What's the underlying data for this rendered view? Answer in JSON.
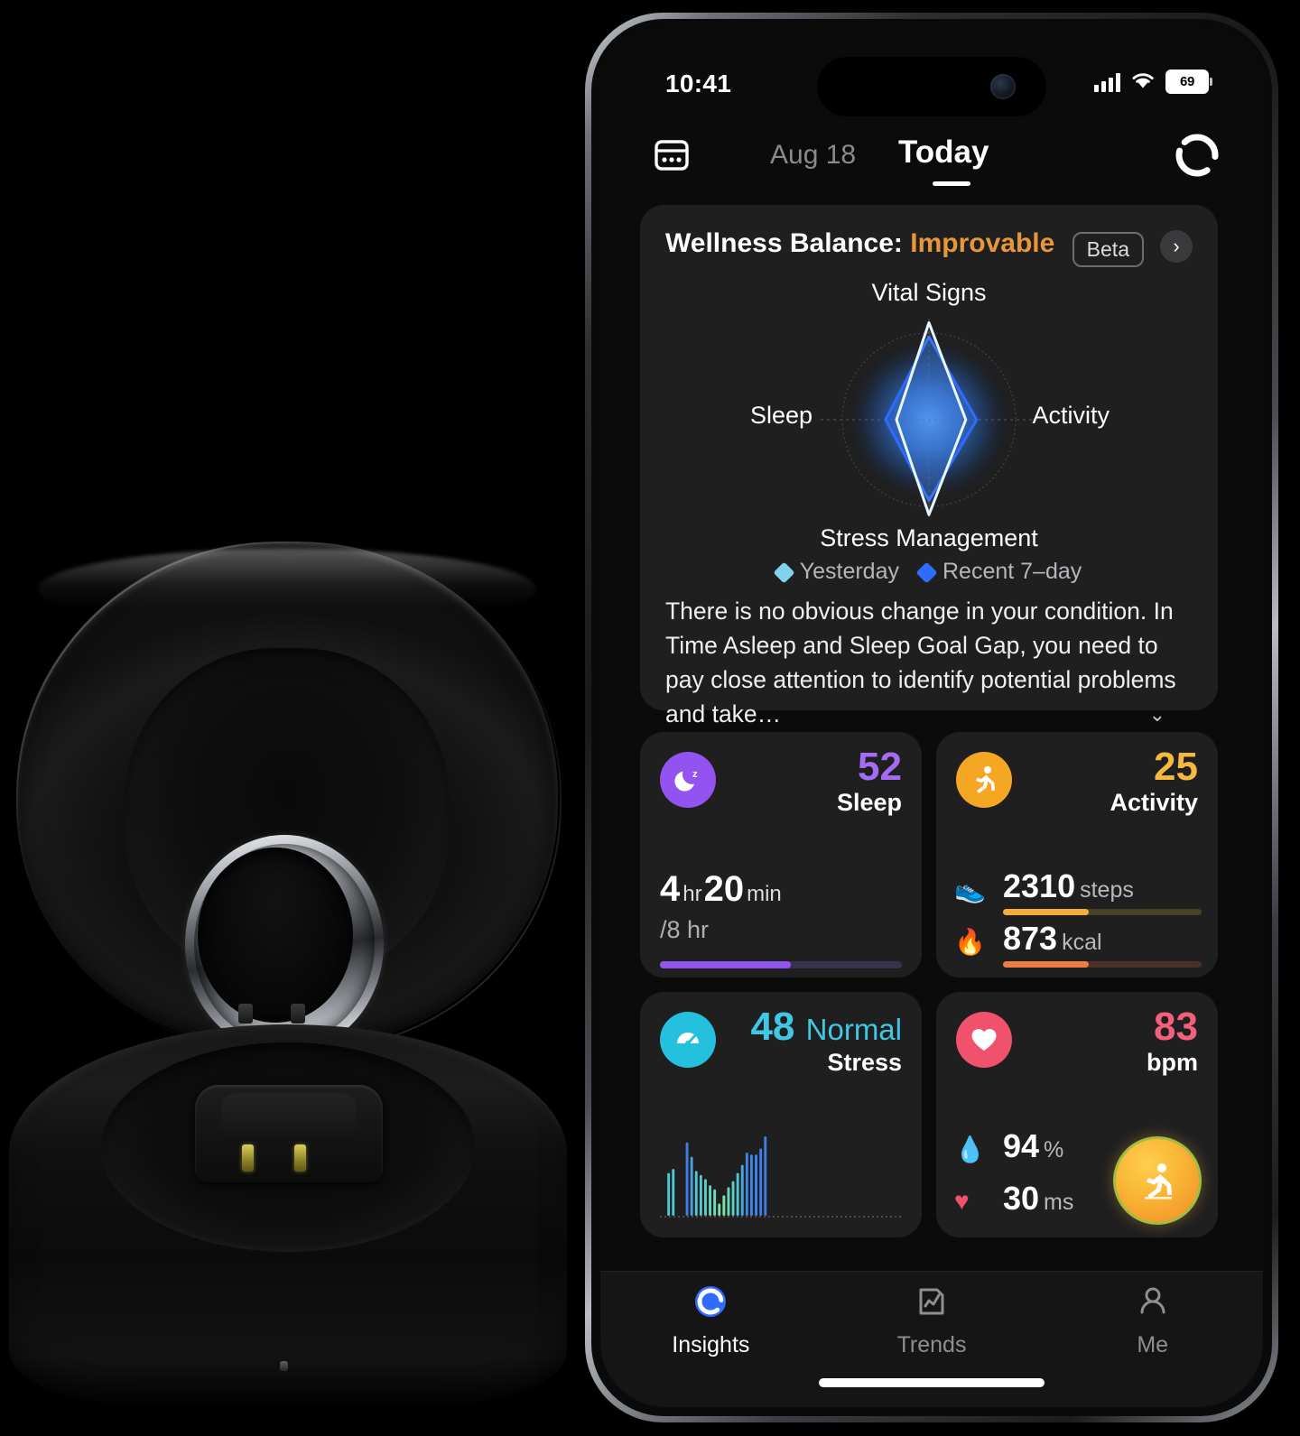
{
  "statusbar": {
    "time": "10:41",
    "battery": "69",
    "icons": [
      "cellular-signal-icon",
      "wifi-icon",
      "battery-icon"
    ]
  },
  "navbar": {
    "calendar_icon": "calendar-card-icon",
    "date": "Aug 18",
    "today": "Today",
    "logo_icon": "ring-logo-icon"
  },
  "wellness": {
    "title_prefix": "Wellness Balance:",
    "status": "Improvable",
    "status_color": "#e8963a",
    "beta_label": "Beta",
    "chevron": "›",
    "description": "There is no obvious change in your condition. In Time Asleep and Sleep Goal Gap, you need to pay close attention to identify potential problems and take…",
    "expand_caret": "⌄",
    "legend": [
      {
        "label": "Yesterday",
        "color": "#7fd3ec"
      },
      {
        "label": "Recent 7–day",
        "color": "#2f6bff"
      }
    ]
  },
  "chart_data": {
    "type": "radar",
    "title": "Wellness Balance",
    "axes": [
      "Vital Signs",
      "Activity",
      "Stress Management",
      "Sleep"
    ],
    "axis_labels": {
      "top": "Vital Signs",
      "right": "Activity",
      "bottom": "Stress Management",
      "left": "Sleep"
    },
    "range": [
      0,
      100
    ],
    "grid": true,
    "legend_position": "bottom",
    "series": [
      {
        "name": "Yesterday",
        "color": "#7fd3ec",
        "values": [
          96,
          34,
          94,
          30
        ]
      },
      {
        "name": "Recent 7–day",
        "color": "#2f6bff",
        "values": [
          82,
          44,
          80,
          40
        ]
      }
    ]
  },
  "metrics": {
    "sleep": {
      "icon": "moon-zzz-icon",
      "icon_color": "#9353f0",
      "score": "52",
      "score_color": "#a46cf5",
      "label": "Sleep",
      "hours": "4",
      "hours_unit": "hr",
      "minutes": "20",
      "minutes_unit": "min",
      "goal": "/8 hr",
      "progress_pct": 54,
      "bar_color": "#9353f0",
      "track_color": "#3a3050"
    },
    "activity": {
      "icon": "running-person-icon",
      "icon_color": "#f5a623",
      "score": "25",
      "score_color": "#f5b940",
      "label": "Activity",
      "rows": [
        {
          "icon": "shoe-icon",
          "glyph": "👟",
          "value": "2310",
          "unit": "steps",
          "progress_pct": 43,
          "color": "#f2ad3b",
          "track": "#4a4226"
        },
        {
          "icon": "flame-icon",
          "glyph": "🔥",
          "value": "873",
          "unit": "kcal",
          "progress_pct": 43,
          "color": "#ef7b47",
          "track": "#4a3026"
        }
      ]
    },
    "stress": {
      "icon": "stress-gauge-icon",
      "icon_color": "#25c0de",
      "score": "48",
      "score_color": "#3fc8e4",
      "status": "Normal",
      "label": "Stress",
      "chart": {
        "type": "bar",
        "values": [
          0,
          0,
          42,
          46,
          0,
          0,
          72,
          58,
          44,
          40,
          36,
          30,
          26,
          12,
          20,
          28,
          34,
          42,
          50,
          62,
          60,
          60,
          66,
          78
        ],
        "colors": [
          "#4ec9d6",
          "#4ec9d6",
          "#4ec9d6",
          "#4ec9d6",
          "#3f7ee8",
          "#3f7ee8",
          "#3f7ee8",
          "#4aa0dd",
          "#56c6cf",
          "#56c6cf",
          "#5fcfc4",
          "#63d2bd",
          "#6ddcb4",
          "#7fe2a8",
          "#7fe2a8",
          "#6ad6bd",
          "#5ccfc9",
          "#52c6d2",
          "#4aa8df",
          "#3f86e8",
          "#3f86e8",
          "#3f86e8",
          "#3f7ee8",
          "#3f7ee8"
        ]
      }
    },
    "heart": {
      "icon": "heart-icon",
      "icon_color": "#f0526e",
      "score": "83",
      "score_color": "#f4607c",
      "label": "bpm",
      "rows": [
        {
          "icon": "blood-drop-icon",
          "glyph": "💧",
          "value": "94",
          "unit": "%"
        },
        {
          "icon": "heart-pulse-icon",
          "glyph": "♥",
          "value": "30",
          "unit": "ms"
        }
      ],
      "fab_icon": "workout-running-icon"
    }
  },
  "tabbar": {
    "items": [
      {
        "label": "Insights",
        "icon": "ring-insights-icon",
        "active": true
      },
      {
        "label": "Trends",
        "icon": "chart-document-icon",
        "active": false
      },
      {
        "label": "Me",
        "icon": "person-icon",
        "active": false
      }
    ]
  }
}
